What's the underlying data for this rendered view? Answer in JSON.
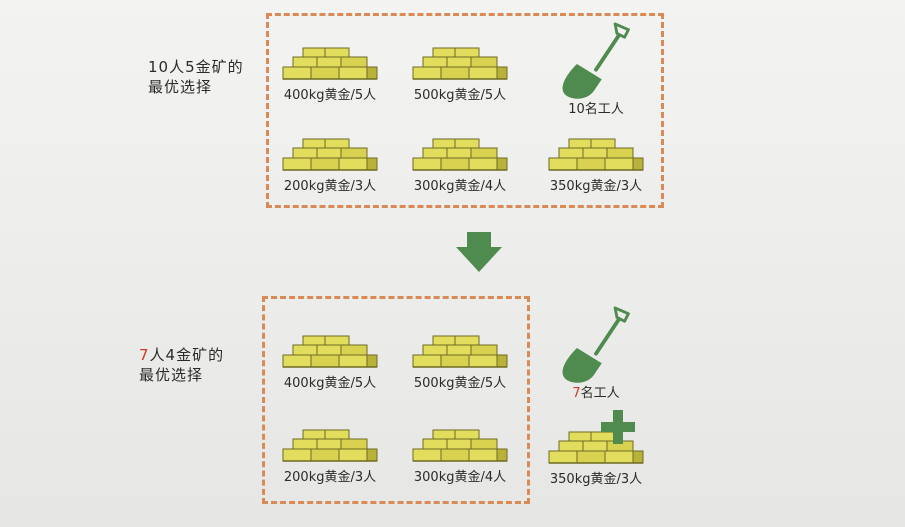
{
  "top": {
    "label_line1": "10人5金矿的",
    "label_line2": "最优选择",
    "mines": [
      {
        "caption": "400kg黄金/5人"
      },
      {
        "caption": "500kg黄金/5人"
      },
      {
        "caption": "200kg黄金/3人"
      },
      {
        "caption": "300kg黄金/4人"
      },
      {
        "caption": "350kg黄金/3人"
      }
    ],
    "workers_caption": "10名工人"
  },
  "bottom": {
    "label_red": "7",
    "label_line1_rest": "人4金矿的",
    "label_line2": "最优选择",
    "mines": [
      {
        "caption": "400kg黄金/5人"
      },
      {
        "caption": "500kg黄金/5人"
      },
      {
        "caption": "200kg黄金/3人"
      },
      {
        "caption": "300kg黄金/4人"
      }
    ],
    "workers_red": "7",
    "workers_rest": "名工人",
    "extra_mine_caption": "350kg黄金/3人"
  },
  "colors": {
    "gold_fill": "#e3dd5e",
    "gold_dark": "#b9b23a",
    "gold_outline": "#6e6a22",
    "dash": "#d98a55",
    "green": "#4f8a4e",
    "red": "#d0392b"
  },
  "icons": [
    "gold-bars-icon",
    "shovel-icon",
    "down-arrow-icon",
    "plus-icon"
  ]
}
